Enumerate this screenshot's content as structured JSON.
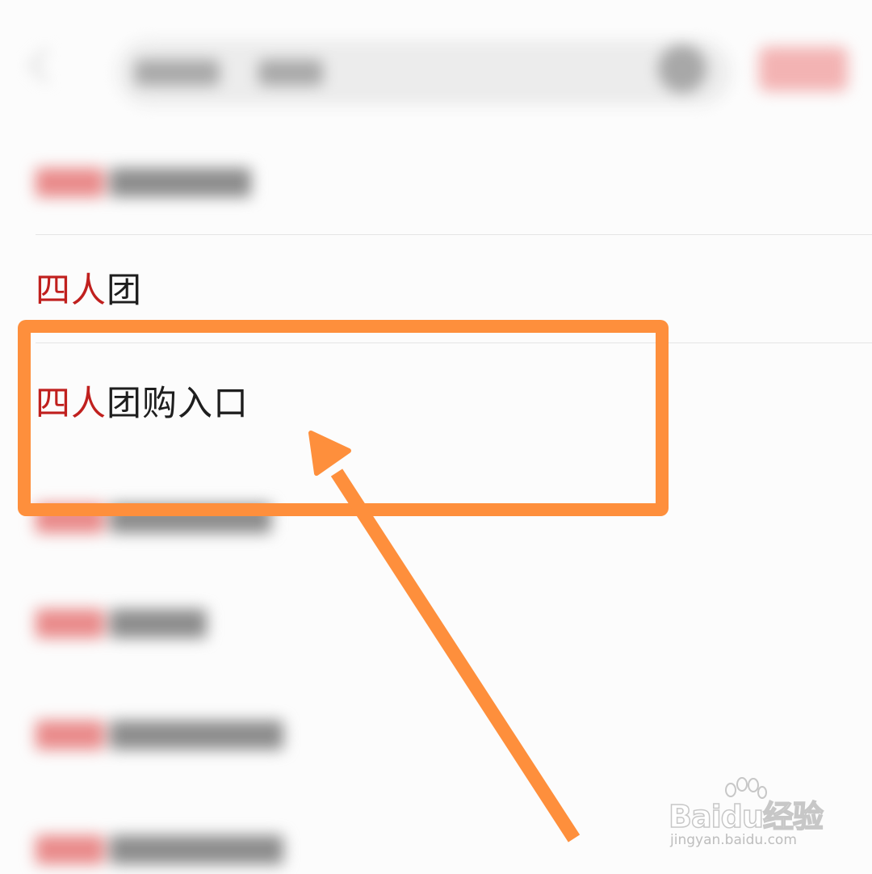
{
  "suggestions": [
    {
      "highlight": "四人",
      "rest": "团",
      "focused": false
    },
    {
      "highlight": "四人",
      "rest": "团购入口",
      "focused": true
    }
  ],
  "colors": {
    "highlight_text": "#c0201e",
    "annotation": "#fe8f3c",
    "background": "#fcfcfc"
  },
  "watermark": {
    "brand_latin_1": "Bai",
    "brand_latin_2": "du",
    "brand_cn": "经验",
    "url": "jingyan.baidu.com"
  }
}
